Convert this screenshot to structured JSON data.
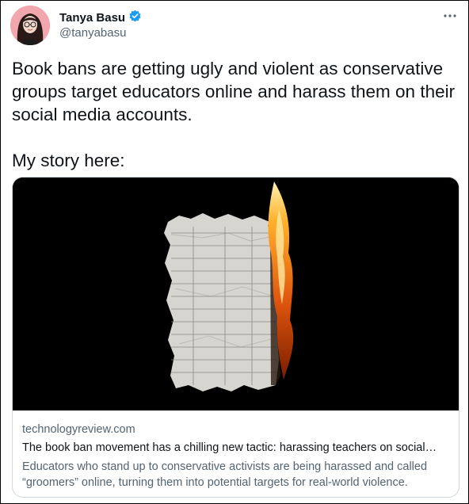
{
  "tweet": {
    "author_name": "Tanya Basu",
    "author_handle": "@tanyabasu",
    "more_icon": "ellipsis-icon",
    "verified_icon": "verified-badge-icon",
    "text_paragraph_1": "Book bans are getting ugly and violent as conservative groups target educators online and harass them on their social media accounts.",
    "text_paragraph_2": "My story here:"
  },
  "card": {
    "domain": "technologyreview.com",
    "title": "The book ban movement has a chilling new tactic: harassing teachers on social…",
    "description": "Educators who stand up to conservative activists are being harassed and called “groomers” online, turning them into potential targets for real-world violence."
  },
  "colors": {
    "verified": "#1d9bf0",
    "secondary_text": "#536471",
    "border": "#cfd9de"
  }
}
